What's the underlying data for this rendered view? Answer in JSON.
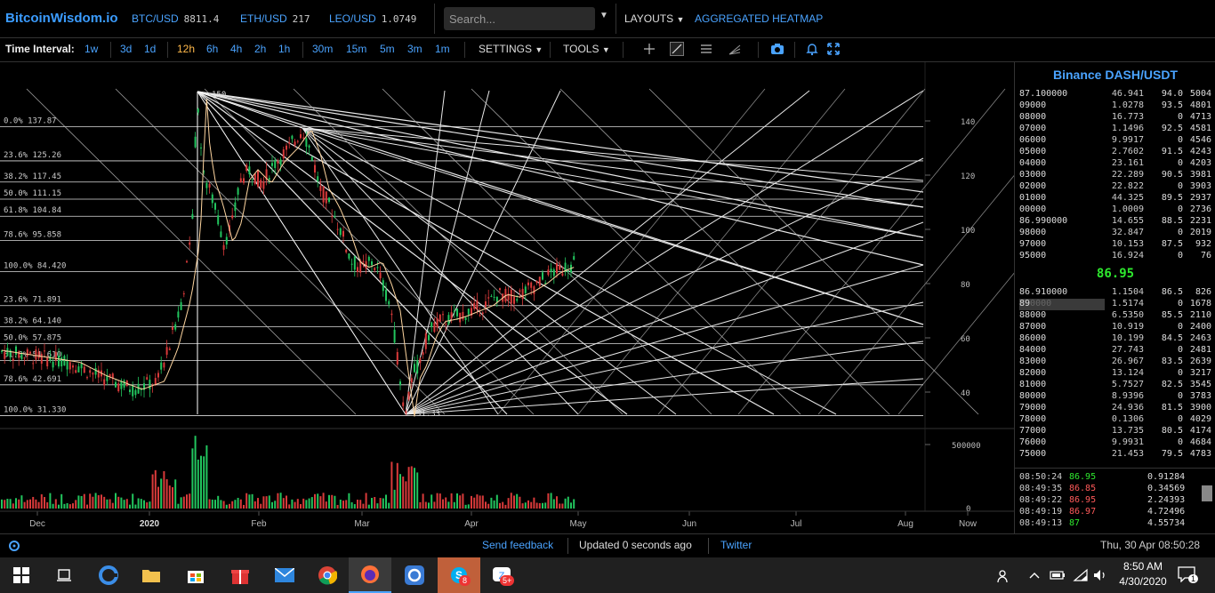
{
  "header": {
    "logo": "BitcoinWisdom.io",
    "tickers": [
      {
        "symbol": "BTC/USD",
        "price": "8811.4"
      },
      {
        "symbol": "ETH/USD",
        "price": "217"
      },
      {
        "symbol": "LEO/USD",
        "price": "1.0749"
      }
    ],
    "search_placeholder": "Search...",
    "layouts_label": "LAYOUTS",
    "heatmap_label": "AGGREGATED HEATMAP"
  },
  "toolbar": {
    "time_interval_label": "Time Interval:",
    "intervals_a": [
      "1w"
    ],
    "intervals_b": [
      "3d",
      "1d"
    ],
    "intervals_c": [
      "12h",
      "6h",
      "4h",
      "2h",
      "1h"
    ],
    "intervals_d": [
      "30m",
      "15m",
      "5m",
      "3m",
      "1m"
    ],
    "active_interval": "12h",
    "settings_label": "SETTINGS",
    "tools_label": "TOOLS"
  },
  "chart": {
    "fib_levels": [
      {
        "label": "0.0% 137.87",
        "price": 137.87
      },
      {
        "label": "23.6% 125.26",
        "price": 125.26
      },
      {
        "label": "38.2% 117.45",
        "price": 117.45
      },
      {
        "label": "50.0% 111.15",
        "price": 111.15
      },
      {
        "label": "61.8% 104.84",
        "price": 104.84
      },
      {
        "label": "78.6% 95.858",
        "price": 95.858
      },
      {
        "label": "100.0% 84.420",
        "price": 84.42
      },
      {
        "label": "23.6% 71.891",
        "price": 71.891
      },
      {
        "label": "38.2% 64.140",
        "price": 64.14
      },
      {
        "label": "50.0% 57.875",
        "price": 57.875
      },
      {
        "label": "61.8% 51.610",
        "price": 51.61
      },
      {
        "label": "78.6% 42.691",
        "price": 42.691
      },
      {
        "label": "100.0% 31.330",
        "price": 31.33
      }
    ],
    "high_label": "150",
    "low_label": "31.33",
    "y_ticks": [
      "140",
      "120",
      "100",
      "80",
      "60",
      "40"
    ],
    "y_tick_values": [
      140,
      120,
      100,
      80,
      60,
      40
    ],
    "volume_ticks": [
      "500000",
      "0"
    ],
    "x_labels": [
      "Dec",
      "2020",
      "Feb",
      "Mar",
      "Apr",
      "May",
      "Jun",
      "Jul",
      "Aug",
      "Now"
    ]
  },
  "orderbook": {
    "title": "Binance DASH/USDT",
    "asks": [
      [
        "87.1",
        "00000",
        "46.941",
        "94.0",
        "5004"
      ],
      [
        "",
        "09000",
        "1.0278",
        "93.5",
        "4801"
      ],
      [
        "",
        "08000",
        "16.773",
        "0",
        "4713"
      ],
      [
        "",
        "07000",
        "1.1496",
        "92.5",
        "4581"
      ],
      [
        "",
        "06000",
        "9.9917",
        "0",
        "4546"
      ],
      [
        "",
        "05000",
        "2.7602",
        "91.5",
        "4243"
      ],
      [
        "",
        "04000",
        "23.161",
        "0",
        "4203"
      ],
      [
        "",
        "03000",
        "22.289",
        "90.5",
        "3981"
      ],
      [
        "",
        "02000",
        "22.822",
        "0",
        "3903"
      ],
      [
        "",
        "01000",
        "44.325",
        "89.5",
        "2937"
      ],
      [
        "",
        "00000",
        "1.0009",
        "0",
        "2736"
      ],
      [
        "86.9",
        "90000",
        "14.655",
        "88.5",
        "2231"
      ],
      [
        "",
        "98000",
        "32.847",
        "0",
        "2019"
      ],
      [
        "",
        "97000",
        "10.153",
        "87.5",
        "932"
      ],
      [
        "",
        "95000",
        "16.924",
        "0",
        "76"
      ]
    ],
    "last_price": "86.95",
    "bids": [
      [
        "86.9",
        "10000",
        "1.1504",
        "86.5",
        "826"
      ],
      [
        "",
        "89",
        "0000",
        "1.5174",
        "0",
        "1678"
      ],
      [
        "",
        "88000",
        "6.5350",
        "85.5",
        "2110"
      ],
      [
        "",
        "87000",
        "10.919",
        "0",
        "2400"
      ],
      [
        "",
        "86000",
        "10.199",
        "84.5",
        "2463"
      ],
      [
        "",
        "84000",
        "27.743",
        "0",
        "2481"
      ],
      [
        "",
        "83000",
        "26.967",
        "83.5",
        "2639"
      ],
      [
        "",
        "82000",
        "13.124",
        "0",
        "3217"
      ],
      [
        "",
        "81000",
        "5.7527",
        "82.5",
        "3545"
      ],
      [
        "",
        "80000",
        "8.9396",
        "0",
        "3783"
      ],
      [
        "",
        "79000",
        "24.936",
        "81.5",
        "3900"
      ],
      [
        "",
        "78000",
        "0.1306",
        "0",
        "4029"
      ],
      [
        "",
        "77000",
        "13.735",
        "80.5",
        "4174"
      ],
      [
        "",
        "76000",
        "9.9931",
        "0",
        "4684"
      ],
      [
        "",
        "75000",
        "21.453",
        "79.5",
        "4783"
      ]
    ],
    "trades": [
      {
        "time": "08:50:24",
        "price": "86.95",
        "amount": "0.91284",
        "side": "buy"
      },
      {
        "time": "08:49:35",
        "price": "86.85",
        "amount": "0.34569",
        "side": "sell"
      },
      {
        "time": "08:49:22",
        "price": "86.95",
        "amount": "2.24393",
        "side": "sell"
      },
      {
        "time": "08:49:19",
        "price": "86.97",
        "amount": "4.72496",
        "side": "sell"
      },
      {
        "time": "08:49:13",
        "price": "87",
        "amount": "4.55734",
        "side": "buy"
      }
    ]
  },
  "status": {
    "feedback": "Send feedback",
    "updated": "Updated 0 seconds ago",
    "twitter": "Twitter",
    "datetime": "Thu, 30 Apr 08:50:28"
  },
  "taskbar": {
    "time": "8:50 AM",
    "date": "4/30/2020",
    "badge_skype": "8",
    "badge_zoom": "5+",
    "notif_count": "1",
    "colors": {
      "accent": "#4aa3ff",
      "up": "#22c55e",
      "down": "#d93a3a"
    }
  }
}
